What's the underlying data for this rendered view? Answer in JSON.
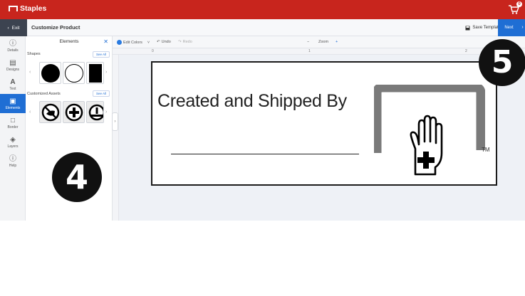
{
  "brand": {
    "name": "Staples",
    "cart_count": "0",
    "accent": "#c8251d"
  },
  "subheader": {
    "exit_label": "Exit",
    "title": "Customize Product",
    "save_template_label": "Save Template",
    "next_label": "Next"
  },
  "rail": {
    "items": [
      {
        "label": "Details",
        "icon": "info-icon"
      },
      {
        "label": "Designs",
        "icon": "designs-icon"
      },
      {
        "label": "Text",
        "icon": "text-icon"
      },
      {
        "label": "Elements",
        "icon": "elements-icon",
        "active": true
      },
      {
        "label": "Border",
        "icon": "border-icon"
      },
      {
        "label": "Layers",
        "icon": "layers-icon"
      },
      {
        "label": "Help",
        "icon": "help-icon"
      }
    ]
  },
  "panel": {
    "title": "Elements",
    "shapes_label": "Shapes",
    "shapes_see_all": "See All",
    "shapes": [
      "filled-circle",
      "outline-circle",
      "filled-rectangle"
    ],
    "assets_label": "Customized Assets",
    "assets_see_all": "See All",
    "assets": [
      "no-hand-icon",
      "plus-circle-icon",
      "medical-icon"
    ]
  },
  "toolbar": {
    "edit_colors": "Edit Colors",
    "undo": "Undo",
    "redo": "Redo",
    "zoom_label": "Zoom"
  },
  "ruler": {
    "marks": [
      "0",
      "1",
      "2"
    ]
  },
  "label": {
    "text": "Created and Shipped By",
    "tm": "TM"
  },
  "callouts": {
    "left": "4",
    "right": "5"
  }
}
